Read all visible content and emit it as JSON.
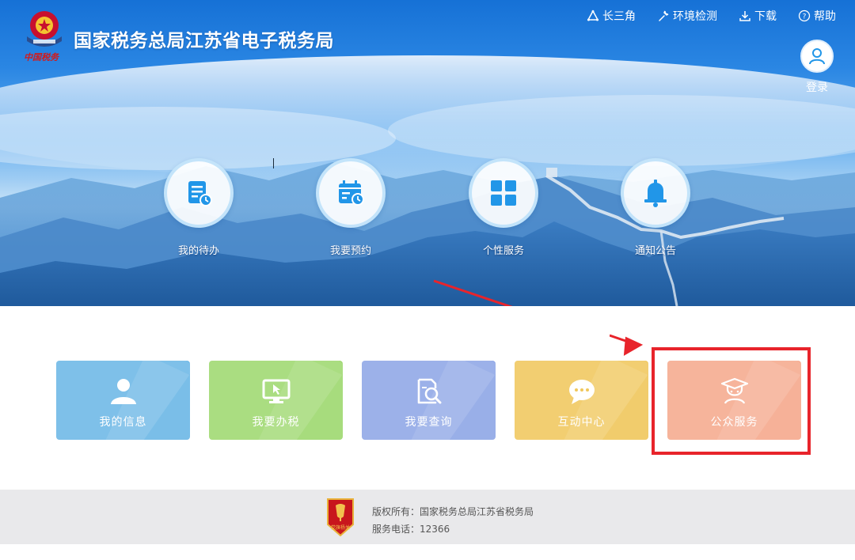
{
  "header": {
    "logo_signature": "中国税务",
    "title": "国家税务总局江苏省电子税务局"
  },
  "topnav": {
    "items": [
      {
        "label": "长三角",
        "icon": "triangle-icon"
      },
      {
        "label": "环境检测",
        "icon": "wrench-icon"
      },
      {
        "label": "下载",
        "icon": "download-icon"
      },
      {
        "label": "帮助",
        "icon": "help-icon"
      }
    ]
  },
  "login": {
    "label": "登录",
    "icon": "user-icon"
  },
  "quick_actions": [
    {
      "label": "我的待办",
      "icon": "todo-document-icon"
    },
    {
      "label": "我要预约",
      "icon": "calendar-appointment-icon"
    },
    {
      "label": "个性服务",
      "icon": "grid-icon"
    },
    {
      "label": "通知公告",
      "icon": "bell-icon"
    }
  ],
  "tiles": [
    {
      "label": "我的信息",
      "icon": "person-icon",
      "color": "#6bb7e6"
    },
    {
      "label": "我要办税",
      "icon": "monitor-cursor-icon",
      "color": "#9ed86f"
    },
    {
      "label": "我要查询",
      "icon": "search-document-icon",
      "color": "#8ea6e6"
    },
    {
      "label": "互动中心",
      "icon": "chat-bubble-icon",
      "color": "#f0c75c"
    },
    {
      "label": "公众服务",
      "icon": "student-icon",
      "color": "#f5a98d"
    }
  ],
  "annotation": {
    "highlight_color": "#e8242b",
    "arrow_color": "#e8242b"
  },
  "footer": {
    "badge_text": "党旗杨关",
    "copyright": "版权所有：国家税务总局江苏省税务局",
    "phone": "服务电话：12366"
  },
  "colors": {
    "brand_blue": "#1e7ad9",
    "icon_blue": "#2196e8"
  }
}
